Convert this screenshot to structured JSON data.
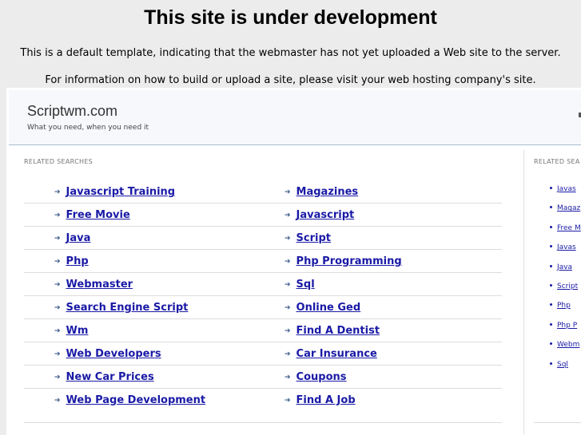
{
  "banner": {
    "title": "This site is under development",
    "line1": "This is a default template, indicating that the webmaster has not yet uploaded a Web site to the server.",
    "line2": "For information on how to build or upload a site, please visit your web hosting company's site."
  },
  "header": {
    "site_name": "Scriptwm.com",
    "tagline": "What you need, when you need it"
  },
  "related": {
    "title": "RELATED SEARCHES",
    "rows": [
      {
        "left": "Javascript Training",
        "right": "Magazines"
      },
      {
        "left": "Free Movie",
        "right": "Javascript"
      },
      {
        "left": "Java",
        "right": "Script"
      },
      {
        "left": "Php",
        "right": "Php Programming"
      },
      {
        "left": "Webmaster",
        "right": "Sql"
      },
      {
        "left": "Search Engine Script",
        "right": "Online Ged"
      },
      {
        "left": "Wm",
        "right": "Find A Dentist"
      },
      {
        "left": "Web Developers",
        "right": "Car Insurance"
      },
      {
        "left": "New Car Prices",
        "right": "Coupons"
      },
      {
        "left": "Web Page Development",
        "right": "Find A Job"
      }
    ]
  },
  "sidebar": {
    "title": "RELATED SEA",
    "items": [
      "Javas",
      "Magaz",
      "Free M",
      "Javas",
      "Java",
      "Script",
      "Php",
      "Php P",
      "Webm",
      "Sql"
    ]
  },
  "colors": {
    "link": "#1a1aa6",
    "header_bg": "#f6f8fb",
    "page_bg": "#ececec"
  }
}
